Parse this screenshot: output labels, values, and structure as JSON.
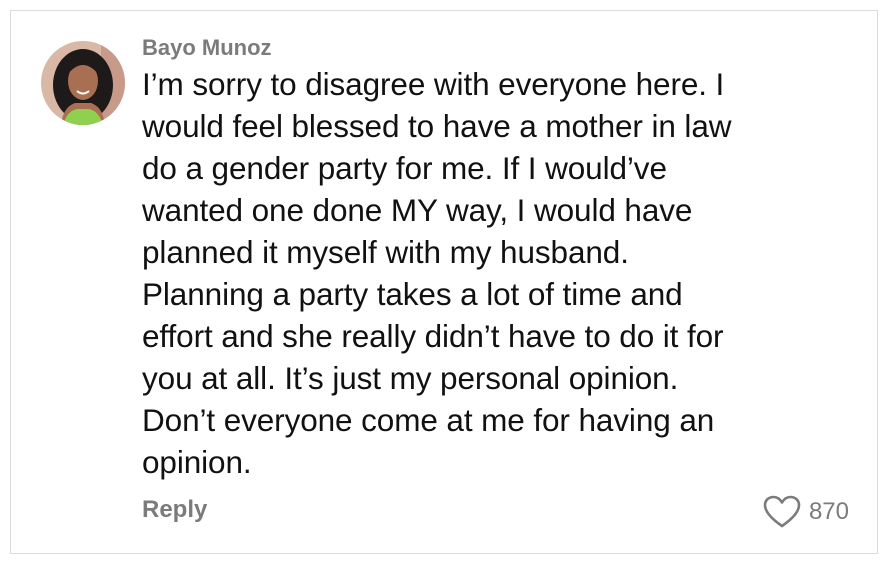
{
  "comment": {
    "author": "Bayo Munoz",
    "text": "I’m sorry to disagree with everyone here. I\nwould feel blessed to have a mother in law\ndo a gender party for me. If I would’ve\nwanted one done MY way, I would have\nplanned it myself with my husband.\nPlanning a party takes a lot of time and\neffort and she really didn’t have to do it for\nyou at all. It’s just my personal opinion.\nDon’t everyone come at me for having an\nopinion.",
    "reply_label": "Reply",
    "like_count": "870",
    "avatar_icon": "user-photo",
    "like_icon": "heart-outline"
  },
  "colors": {
    "muted_text": "#7b7b7b",
    "body_text": "#111111",
    "border": "#dcdcdc"
  }
}
